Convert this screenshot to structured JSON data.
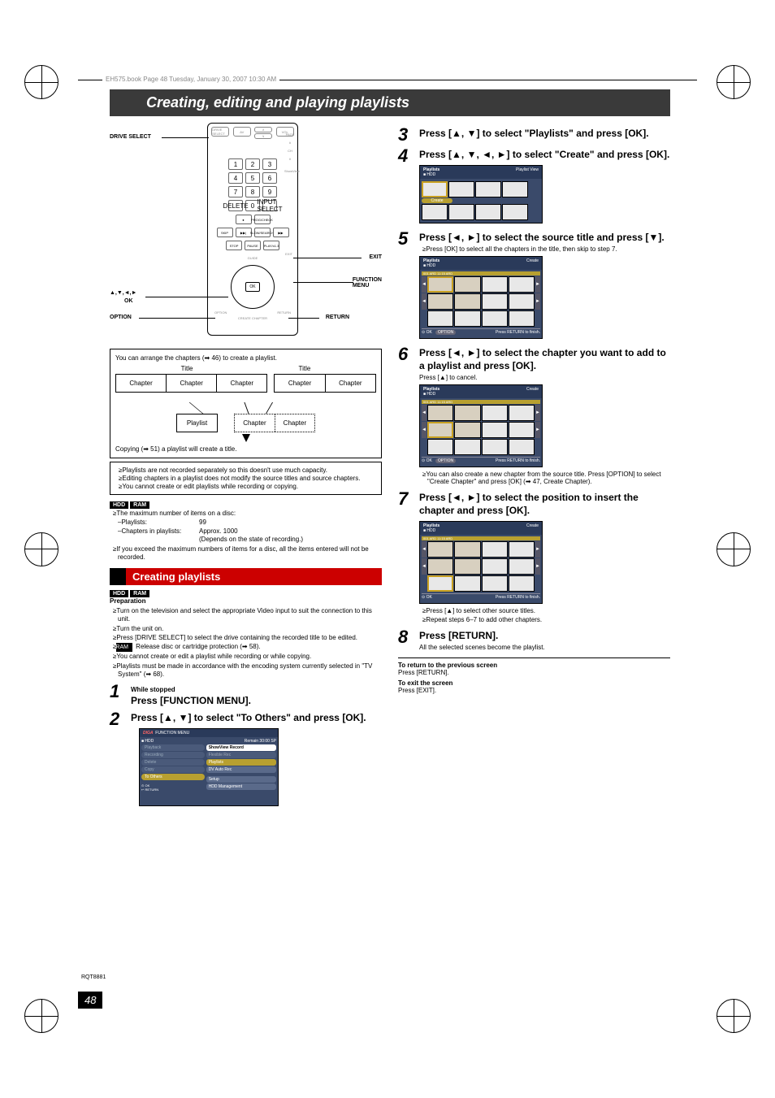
{
  "meta": {
    "header": "EH575.book  Page 48  Tuesday, January 30, 2007  10:30 AM",
    "rqt": "RQT8881",
    "page": "48"
  },
  "title": "Creating, editing and playing playlists",
  "remote": {
    "drive_select": "DRIVE SELECT",
    "exit": "EXIT",
    "function_menu": "FUNCTION\nMENU",
    "arrows": "▲,▼,◄,►",
    "ok": "OK",
    "option": "OPTION",
    "return": "RETURN",
    "keys": [
      "1",
      "2",
      "3",
      "4",
      "5",
      "6",
      "7",
      "8",
      "9",
      "0"
    ],
    "ok_btn": "OK",
    "side": {
      "page": "PAGE",
      "ch": "CH",
      "showview": "ShowView"
    },
    "labels": {
      "drive": "DRIVE SELECT",
      "delete": "DELETE",
      "input": "INPUT SELECT",
      "prog": "PROG/CHECK",
      "stop": "STOP",
      "pause": "PAUSE",
      "play": "PLAY/x1.3",
      "guide": "GUIDE",
      "skip": "SKIP",
      "search": "SLOW/SEARCH",
      "create": "CREATE CHAPTER"
    }
  },
  "diagram": {
    "intro": "You can arrange the chapters (➡ 46) to create a playlist.",
    "title_label": "Title",
    "chapter": "Chapter",
    "playlist": "Playlist",
    "copy": "Copying (➡ 51) a playlist will create a title."
  },
  "notes_box": {
    "n1": "≥Playlists are not recorded separately so this doesn't use much capacity.",
    "n2": "≥Editing chapters in a playlist does not modify the source titles and source chapters.",
    "n3": "≥You cannot create or edit playlists while recording or copying."
  },
  "badges": {
    "hdd": "HDD",
    "ram": "RAM"
  },
  "max_items": {
    "line1": "≥The maximum number of items on a disc:",
    "playlists_label": "–Playlists:",
    "playlists_val": "99",
    "chapters_label": "–Chapters in playlists:",
    "chapters_val": "Approx. 1000",
    "depends": "(Depends on the state of recording.)",
    "exceed": "≥If you exceed the maximum numbers of items for a disc, all the items entered will not be recorded."
  },
  "section": "Creating playlists",
  "prep": {
    "heading": "Preparation",
    "p1": "≥Turn on the television and select the appropriate Video input to suit the connection to this unit.",
    "p2": "≥Turn the unit on.",
    "p3": "≥Press [DRIVE SELECT] to select the drive containing the recorded title to be edited.",
    "p4": " Release disc or cartridge protection (➡ 58).",
    "p5": "≥You cannot create or edit a playlist while recording or while copying.",
    "p6": "≥Playlists must be made in accordance with the encoding system currently selected in \"TV System\" (➡ 68)."
  },
  "steps": {
    "s1_pre": "While stopped",
    "s1": "Press [FUNCTION MENU].",
    "s2": "Press [▲, ▼] to select \"To Others\" and press [OK].",
    "s3": "Press [▲, ▼] to select \"Playlists\" and press [OK].",
    "s4": "Press [▲, ▼, ◄, ►] to select \"Create\" and press [OK].",
    "s5": "Press [◄, ►] to select the source title and press [▼].",
    "s5_note": "≥Press [OK] to select all the chapters in the title, then skip to step 7.",
    "s6": "Press [◄, ►] to select the chapter you want to add to a playlist and press [OK].",
    "s6_pre": "Press [▲] to cancel.",
    "s6_note1": "≥You can also create a new chapter from the source title. Press [OPTION] to select \"Create Chapter\" and press [OK] (➡ 47, Create Chapter).",
    "s7": "Press [◄, ►] to select the position to insert the chapter and press [OK].",
    "s7_note1": "≥Press [▲] to select other source titles.",
    "s7_note2": "≥Repeat steps 6–7 to add other chapters.",
    "s8": "Press [RETURN].",
    "s8_note": "All the selected scenes become the playlist."
  },
  "screens": {
    "func_header_left": "FUNCTION MENU",
    "func_header_right": "Remain  30:00 SP",
    "hdd": "HDD",
    "sidebar": [
      "Playback",
      "Recording",
      "Delete",
      "Copy",
      "To Others"
    ],
    "main": [
      "ShowView Record",
      "Flexible Rec",
      "Playlists",
      "DV Auto Rec",
      "Setup",
      "HDD Management"
    ],
    "pl_header": "Playlists",
    "pl_view": "Playlist View",
    "create": "Create",
    "press_return": "Press RETURN to finish.",
    "option": "OPTION",
    "title_time": "001 ARD 11:15 ARD"
  },
  "footer": {
    "prev_h": "To return to the previous screen",
    "prev": "Press [RETURN].",
    "exit_h": "To exit the screen",
    "exit": "Press [EXIT]."
  }
}
